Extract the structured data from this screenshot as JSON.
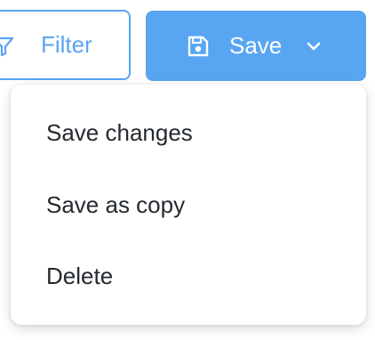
{
  "toolbar": {
    "filter_label": "Filter",
    "filter_icon": "filter-icon",
    "save_label": "Save",
    "save_icon": "floppy-disk-icon",
    "dropdown_icon": "chevron-down-icon"
  },
  "menu": {
    "items": [
      {
        "label": "Save changes"
      },
      {
        "label": "Save as copy"
      },
      {
        "label": "Delete"
      }
    ]
  },
  "colors": {
    "accent": "#58a5f2",
    "text": "#24292f",
    "background": "#ffffff"
  }
}
